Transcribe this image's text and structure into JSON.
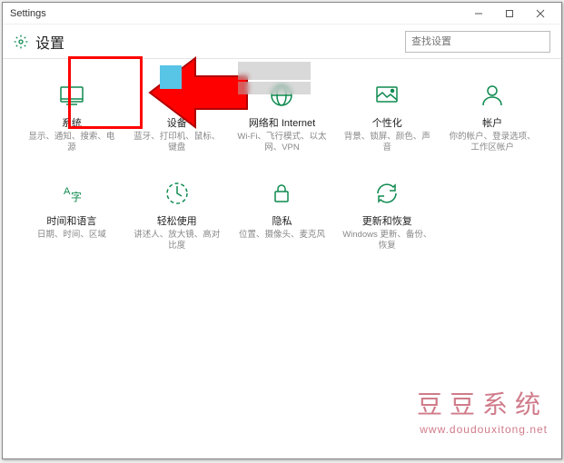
{
  "window": {
    "title": "Settings"
  },
  "colors": {
    "accent": "#0e8a4f",
    "annotation": "#ff0000",
    "watermark": "#d07b8a"
  },
  "header": {
    "title": "设置",
    "search_placeholder": "查找设置"
  },
  "tiles": [
    {
      "id": "system",
      "title": "系统",
      "desc": "显示、通知、搜索、电源"
    },
    {
      "id": "devices",
      "title": "设备",
      "desc": "蓝牙、打印机、鼠标、键盘"
    },
    {
      "id": "network",
      "title": "网络和 Internet",
      "desc": "Wi-Fi、飞行模式、以太网、VPN"
    },
    {
      "id": "personalization",
      "title": "个性化",
      "desc": "背景、锁屏、颜色、声音"
    },
    {
      "id": "accounts",
      "title": "帐户",
      "desc": "你的帐户、登录选项、工作区帐户"
    },
    {
      "id": "time-language",
      "title": "时间和语言",
      "desc": "日期、时间、区域"
    },
    {
      "id": "ease-of-access",
      "title": "轻松使用",
      "desc": "讲述人、放大镜、高对比度"
    },
    {
      "id": "privacy",
      "title": "隐私",
      "desc": "位置、摄像头、麦克风"
    },
    {
      "id": "update-security",
      "title": "更新和恢复",
      "desc": "Windows 更新、备份、恢复"
    }
  ],
  "watermark": {
    "main": "豆豆系统",
    "sub": "www.doudouxitong.net"
  }
}
